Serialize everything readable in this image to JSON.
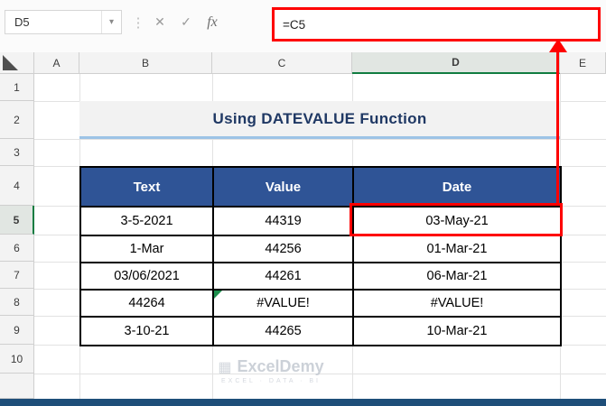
{
  "toolbar": {
    "name_box": "D5",
    "formula": "=C5"
  },
  "icons": {
    "dropdown": "▾",
    "more": "⋮",
    "cancel": "✕",
    "enter": "✓",
    "fx": "fx",
    "watermark_grid": "▦"
  },
  "sheet": {
    "columns": [
      "A",
      "B",
      "C",
      "D",
      "E"
    ],
    "rows": [
      "1",
      "2",
      "3",
      "4",
      "5",
      "6",
      "7",
      "8",
      "9",
      "10"
    ],
    "selected_column": "D",
    "selected_row": "5",
    "active_cell": "D5"
  },
  "title": "Using DATEVALUE Function",
  "table": {
    "headers": [
      "Text",
      "Value",
      "Date"
    ],
    "rows": [
      [
        "3-5-2021",
        "44319",
        "03-May-21"
      ],
      [
        "1-Mar",
        "44256",
        "01-Mar-21"
      ],
      [
        "03/06/2021",
        "44261",
        "06-Mar-21"
      ],
      [
        "44264",
        "#VALUE!",
        "#VALUE!"
      ],
      [
        "3-10-21",
        "44265",
        "10-Mar-21"
      ]
    ]
  },
  "watermark": {
    "name": "ExcelDemy",
    "tagline": "EXCEL · DATA · BI"
  },
  "colors": {
    "table_header_blue": "#2f5496",
    "title_text_navy": "#1f3864",
    "title_underline_blue": "#9dc3e6",
    "annotation_red": "#fe0000",
    "selection_green": "#107c41",
    "bottom_bar_blue": "#1e4e79"
  }
}
